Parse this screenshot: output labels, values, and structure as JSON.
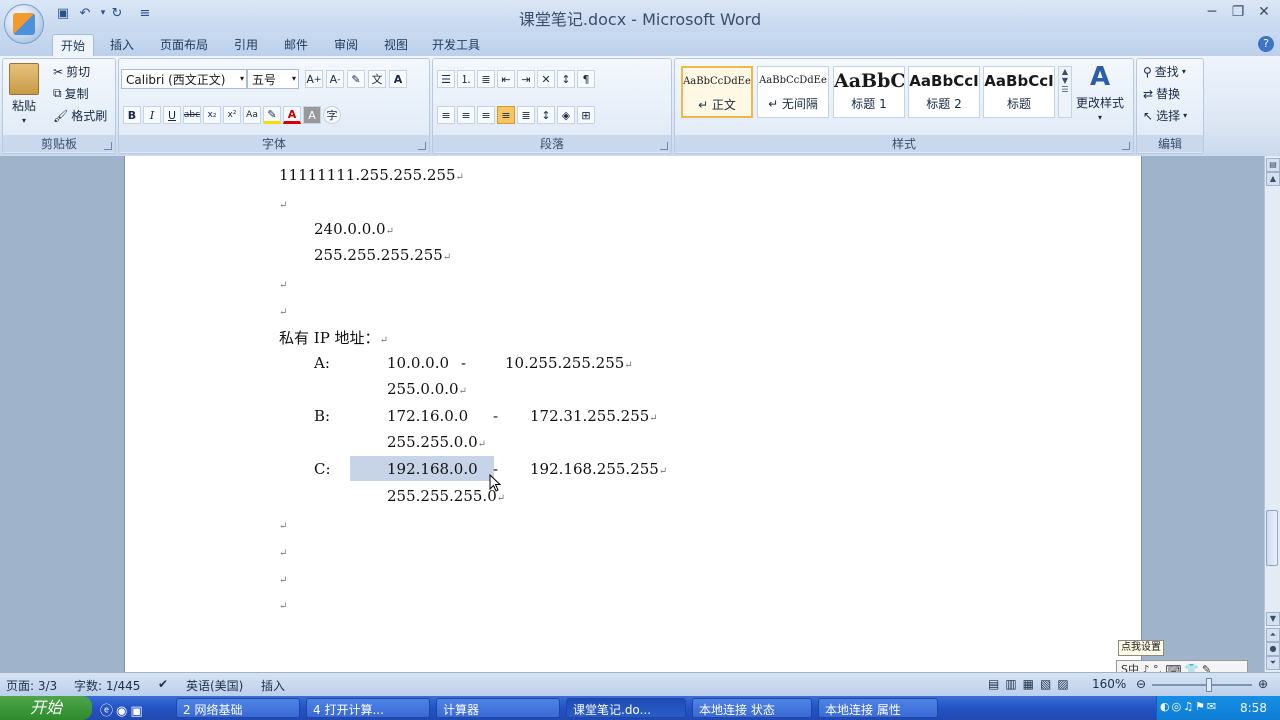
{
  "window_title": "课堂笔记.docx - Microsoft Word",
  "tabs": [
    "开始",
    "插入",
    "页面布局",
    "引用",
    "邮件",
    "审阅",
    "视图",
    "开发工具"
  ],
  "clipboard": {
    "paste": "粘贴",
    "cut": "剪切",
    "copy": "复制",
    "format_painter": "格式刷",
    "label": "剪贴板"
  },
  "font": {
    "name": "Calibri (西文正文)",
    "size": "五号",
    "label": "字体"
  },
  "paragraph": {
    "label": "段落"
  },
  "styles": {
    "items": [
      {
        "preview": "AaBbCcDdEe",
        "name": "↵ 正文"
      },
      {
        "preview": "AaBbCcDdEe",
        "name": "↵ 无间隔"
      },
      {
        "preview": "AaBbC",
        "name": "标题 1"
      },
      {
        "preview": "AaBbCcI",
        "name": "标题 2"
      },
      {
        "preview": "AaBbCcI",
        "name": "标题"
      }
    ],
    "change": "更改样式",
    "label": "样式"
  },
  "editing": {
    "find": "查找",
    "replace": "替换",
    "select": "选择",
    "label": "编辑"
  },
  "document": {
    "line1": "11111111.255.255.255",
    "line2": "240.0.0.0",
    "line3": "255.255.255.255",
    "private_heading": "私有 IP 地址：",
    "classes": [
      {
        "label": "A:",
        "start": "10.0.0.0",
        "dash": "-",
        "end": "10.255.255.255",
        "mask": "255.0.0.0"
      },
      {
        "label": "B:",
        "start": "172.16.0.0",
        "dash": "-",
        "end": "172.31.255.255",
        "mask": "255.255.0.0"
      },
      {
        "label": "C:",
        "start": "192.168.0.0",
        "dash": "-",
        "end": "192.168.255.255",
        "mask": "255.255.255.0"
      }
    ],
    "para_mark": "↵"
  },
  "status": {
    "page": "页面: 3/3",
    "words": "字数: 1/445",
    "lang": "英语(美国)",
    "mode": "插入",
    "zoom": "160%"
  },
  "ime": {
    "tip": "点我设置",
    "bar": "S中 ♪ °, ⌨ 👕 ✎"
  },
  "taskbar": {
    "start": "开始",
    "tasks": [
      "2 网络基础",
      "4 打开计算...",
      "计算器",
      "课堂笔记.do...",
      "本地连接 状态",
      "本地连接 属性"
    ],
    "clock": "8:58"
  },
  "colors": {
    "accent": "#2453c4",
    "selection": "#c7d3e6"
  }
}
